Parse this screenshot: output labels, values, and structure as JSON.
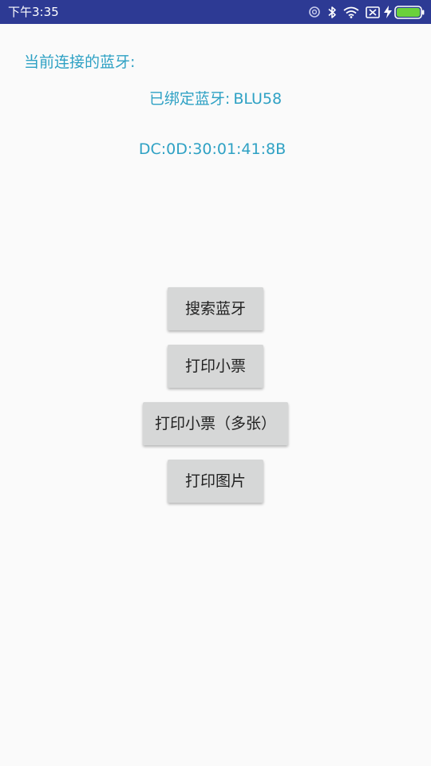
{
  "status_bar": {
    "time": "下午3:35",
    "icons": [
      "alarm-icon",
      "bluetooth-icon",
      "wifi-icon",
      "no-sim-icon",
      "charging-icon",
      "battery-icon"
    ],
    "colors": {
      "background": "#2d3a94",
      "battery": "#6ad13b"
    }
  },
  "bluetooth": {
    "current_label": "当前连接的蓝牙:",
    "bound_label": "已绑定蓝牙:",
    "device_name": "BLU58",
    "mac_address": "DC:0D:30:01:41:8B"
  },
  "buttons": {
    "search": "搜索蓝牙",
    "print_ticket": "打印小票",
    "print_ticket_multi": "打印小票（多张）",
    "print_image": "打印图片"
  },
  "colors": {
    "accent_text": "#2ea1c4",
    "button_bg": "#d6d7d7",
    "page_bg": "#fafafa"
  }
}
